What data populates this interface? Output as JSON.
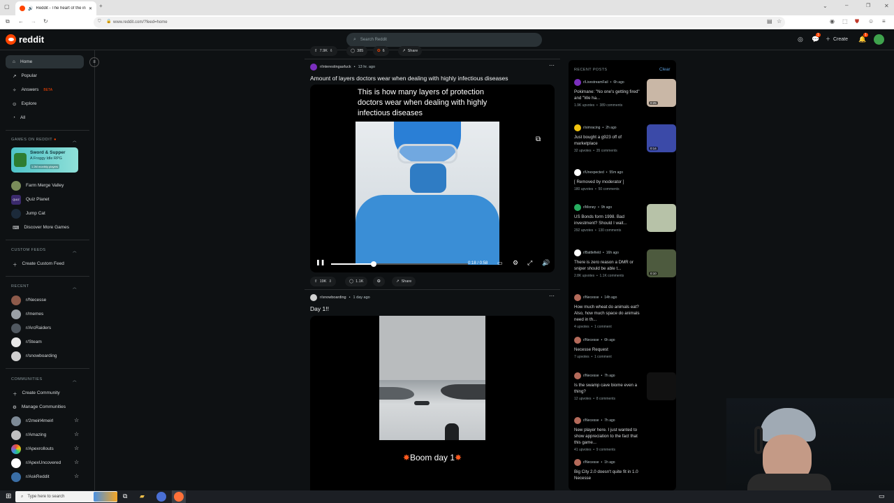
{
  "browser": {
    "tab_title": "Reddit - The heart of the in",
    "url": "www.reddit.com/?feed=home"
  },
  "header": {
    "logo_text": "reddit",
    "search_placeholder": "Search Reddit",
    "create_label": "Create",
    "chat_badge": "1",
    "notif_badge": "1"
  },
  "sidebar": {
    "nav": [
      {
        "label": "Home",
        "icon": "home-icon"
      },
      {
        "label": "Popular",
        "icon": "popular-icon"
      },
      {
        "label": "Answers",
        "icon": "answers-icon",
        "badge": "BETA"
      },
      {
        "label": "Explore",
        "icon": "explore-icon"
      },
      {
        "label": "All",
        "icon": "all-icon"
      }
    ],
    "games_header": "GAMES ON REDDIT",
    "game_banner": {
      "title": "Sword & Supper",
      "subtitle": "A Froggy Idle RPG",
      "players": "1.2M monthly players"
    },
    "games": [
      "Farm Merge Valley",
      "Quiz Planet",
      "Jump Cat",
      "Discover More Games"
    ],
    "custom_feeds_header": "CUSTOM FEEDS",
    "create_custom_feed": "Create Custom Feed",
    "recent_header": "RECENT",
    "recent": [
      "r/Necesse",
      "r/memes",
      "r/ArcRaiders",
      "r/Steam",
      "r/snowboarding"
    ],
    "communities_header": "COMMUNITIES",
    "create_community": "Create Community",
    "manage_communities": "Manage Communities",
    "communities": [
      "r/2meirl4meirl",
      "r/Amazing",
      "r/Apexrollouts",
      "r/ApexUncovered",
      "r/AskReddit"
    ]
  },
  "feed": {
    "prev_post": {
      "votes": "7.9K",
      "comments": "385",
      "awards": "6",
      "share": "Share"
    },
    "post1": {
      "subreddit": "r/interestingasfuck",
      "age": "13 hr. ago",
      "title": "Amount of layers doctors wear when dealing with highly infectious diseases",
      "video_caption": "This is how many layers of protection doctors wear when dealing with highly infectious diseases",
      "time": "0:18 / 0:58",
      "progress": 0.31,
      "votes": "19K",
      "comments": "1.1K",
      "share": "Share"
    },
    "post2": {
      "subreddit": "r/snowboarding",
      "age": "1 day ago",
      "title": "Day 1!!",
      "video_caption": "Boom day 1"
    }
  },
  "recent_posts": {
    "header": "RECENT POSTS",
    "clear": "Clear",
    "items": [
      {
        "sub": "r/LivestreamFail",
        "age": "6h ago",
        "title": "Pokimane: \"No one's getting fired\" and \"We ha...",
        "upvotes": "1.9K upvotes",
        "comments": "389 comments",
        "thumb_time": "0:25",
        "icon_color": "#7b2fbe",
        "thumb": "#c9b7a6"
      },
      {
        "sub": "r/simracing",
        "age": "2h ago",
        "title": "Just bought a g923 off of marketplace",
        "upvotes": "32 upvotes",
        "comments": "35 comments",
        "thumb_time": "0:14",
        "icon_color": "#f1c40f",
        "thumb": "#3b4aa8"
      },
      {
        "sub": "r/Unexpected",
        "age": "55m ago",
        "title": "[ Removed by moderator ]",
        "upvotes": "180 upvotes",
        "comments": "50 comments",
        "icon_color": "#ffffff"
      },
      {
        "sub": "r/Money",
        "age": "9h ago",
        "title": "US Bonds form 1998. Bad investment? Should I wait...",
        "upvotes": "292 upvotes",
        "comments": "130 comments",
        "icon_color": "#27ae60",
        "thumb": "#b7c2a8"
      },
      {
        "sub": "r/Battlefield",
        "age": "16h ago",
        "title": "There is zero reason a DMR or sniper should be able t...",
        "upvotes": "2.8K upvotes",
        "comments": "1.1K comments",
        "thumb_time": "0:10",
        "icon_color": "#ffffff",
        "thumb": "#4d5a3e"
      },
      {
        "sub": "r/Necesse",
        "age": "14h ago",
        "title": "How much wheat do animals eat? Also, how much space do animals need in th...",
        "upvotes": "4 upvotes",
        "comments": "1 comment",
        "icon_color": "#b46a5a"
      },
      {
        "sub": "r/Necesse",
        "age": "6h ago",
        "title": "Necesse Request",
        "upvotes": "7 upvotes",
        "comments": "1 comment",
        "icon_color": "#b46a5a"
      },
      {
        "sub": "r/Necesse",
        "age": "7h ago",
        "title": "Is the swamp cave biome even a thing?",
        "upvotes": "12 upvotes",
        "comments": "8 comments",
        "icon_color": "#b46a5a",
        "thumb": "#111111"
      },
      {
        "sub": "r/Necesse",
        "age": "7h ago",
        "title": "New player here. I just wanted to show appreciation to the fact that this game...",
        "upvotes": "41 upvotes",
        "comments": "9 comments",
        "icon_color": "#b46a5a"
      },
      {
        "sub": "r/Necesse",
        "age": "1h ago",
        "title": "Big City 2.0 doesn't quite fit in 1.0 Necesse",
        "icon_color": "#b46a5a"
      }
    ]
  },
  "taskbar": {
    "search_placeholder": "Type here to search"
  }
}
